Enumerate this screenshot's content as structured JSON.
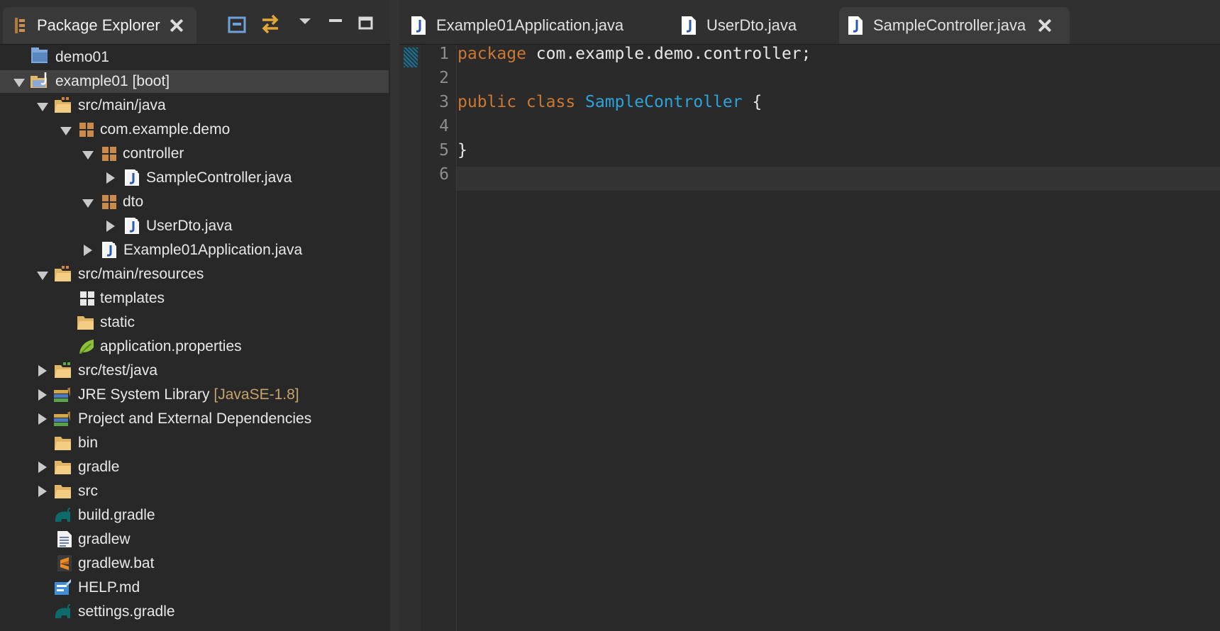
{
  "package_explorer": {
    "title": "Package Explorer",
    "tree": [
      {
        "label": "demo01"
      },
      {
        "label": "example01 [boot]"
      },
      {
        "label": "src/main/java"
      },
      {
        "label": "com.example.demo"
      },
      {
        "label": "controller"
      },
      {
        "label": "SampleController.java"
      },
      {
        "label": "dto"
      },
      {
        "label": "UserDto.java"
      },
      {
        "label": "Example01Application.java"
      },
      {
        "label": "src/main/resources"
      },
      {
        "label": "templates"
      },
      {
        "label": "static"
      },
      {
        "label": "application.properties"
      },
      {
        "label": "src/test/java"
      },
      {
        "label": "JRE System Library",
        "decoration": "[JavaSE-1.8]"
      },
      {
        "label": "Project and External Dependencies"
      },
      {
        "label": "bin"
      },
      {
        "label": "gradle"
      },
      {
        "label": "src"
      },
      {
        "label": "build.gradle"
      },
      {
        "label": "gradlew"
      },
      {
        "label": "gradlew.bat"
      },
      {
        "label": "HELP.md"
      },
      {
        "label": "settings.gradle"
      }
    ]
  },
  "editor": {
    "tabs": [
      {
        "label": "Example01Application.java"
      },
      {
        "label": "UserDto.java"
      },
      {
        "label": "SampleController.java"
      }
    ],
    "line_numbers": [
      "1",
      "2",
      "3",
      "4",
      "5",
      "6"
    ],
    "code": {
      "l1_kw": "package",
      "l1_rest": " com.example.demo.controller;",
      "l3_kw": "public class",
      "l3_cls": "SampleController",
      "l3_rest": " {",
      "l5": "}"
    }
  },
  "colors": {
    "keyword": "#cc7832",
    "class_name": "#2ea3d8",
    "decoration": "#c4a36a"
  }
}
